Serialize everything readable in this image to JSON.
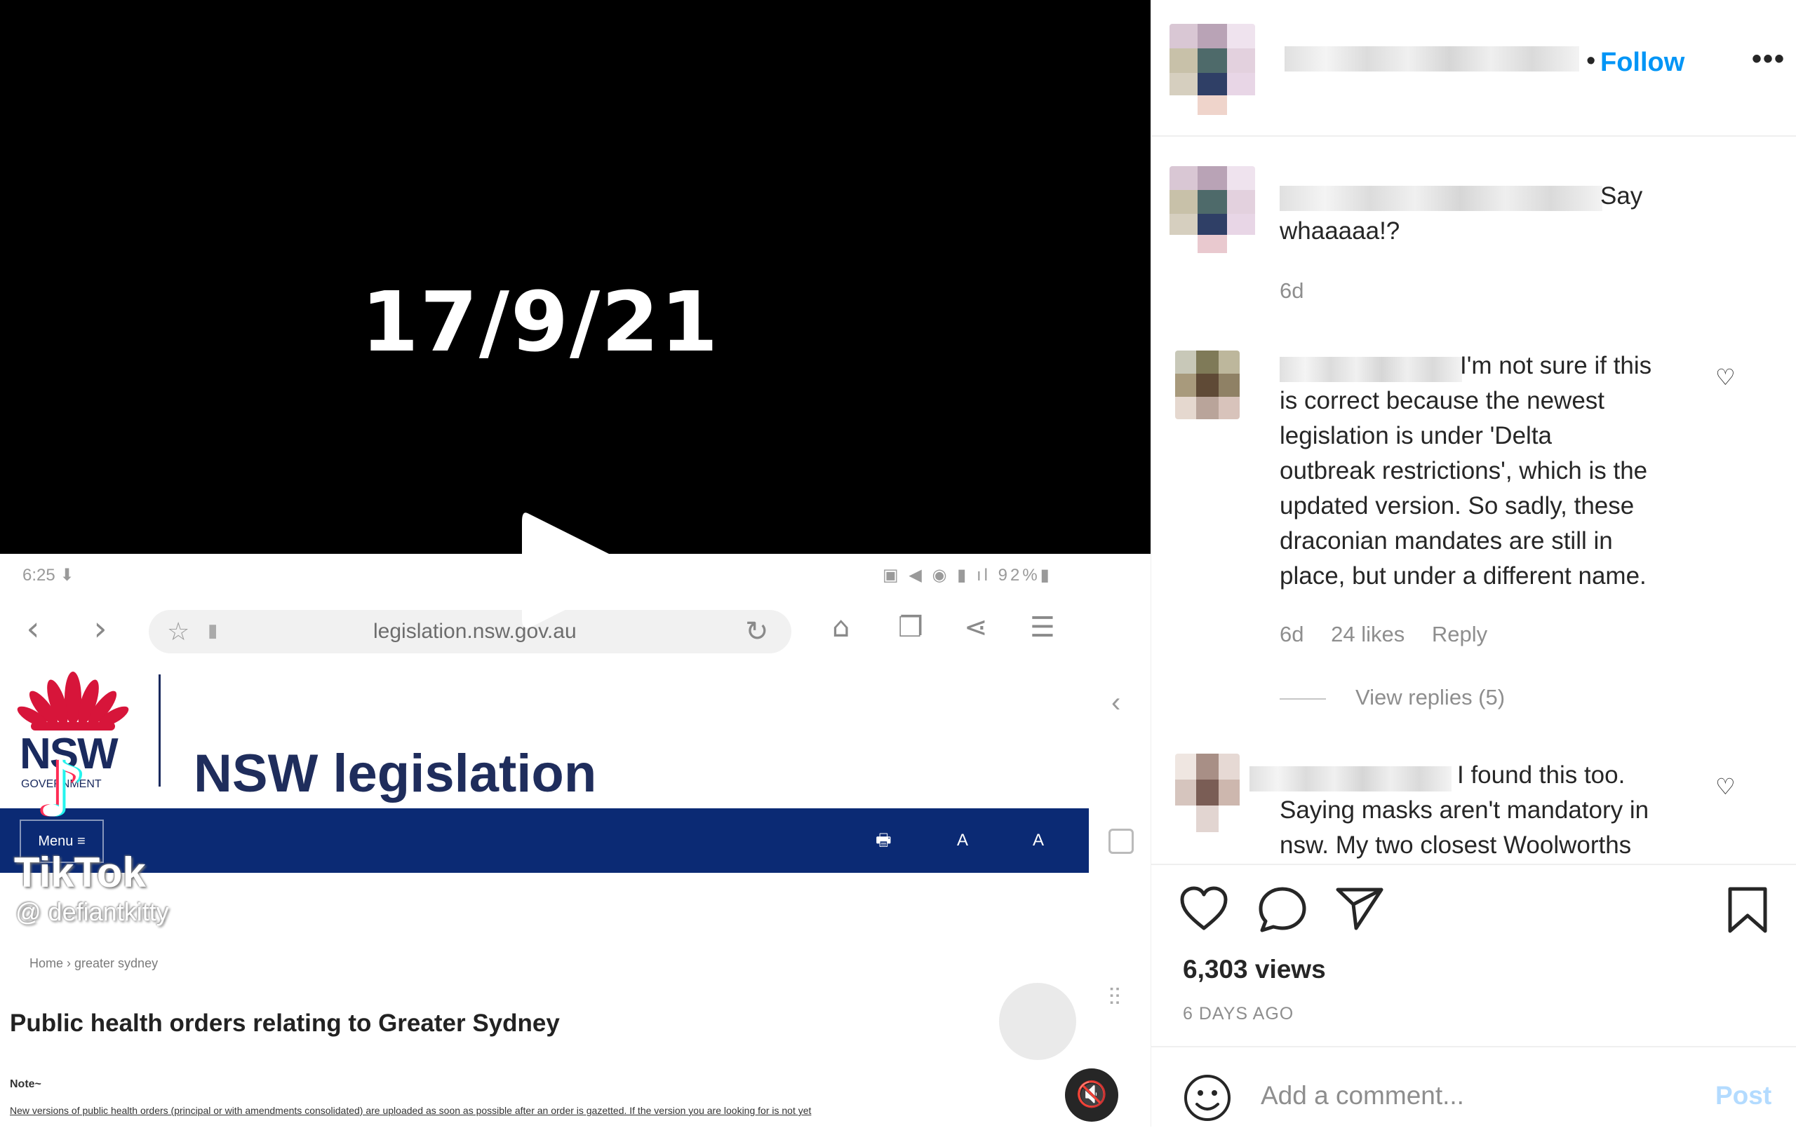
{
  "video": {
    "date_text": "17/9/21",
    "phone": {
      "status_time": "6:25 ⬇",
      "status_icons": "▣ ◀ ◉ ▮ ıl 92%▮",
      "url": "legislation.nsw.gov.au"
    },
    "site": {
      "logo_text": "NSW",
      "logo_subtext": "GOVERNMENT",
      "title": "NSW legislation",
      "menu_label": "Menu ≡",
      "toolbar_glyphs": "🖶 A A"
    },
    "tiktok": {
      "logo_glyph": "♪",
      "name": "TikTok",
      "handle": "@ defiantkitty"
    },
    "breadcrumb": "Home  ›  greater sydney",
    "page_heading": "Public health orders relating to Greater Sydney",
    "note_label": "Note~",
    "note_text": "New versions of public health orders (principal or with amendments consolidated) are uploaded as soon as possible after an order is gazetted. If the version you are looking for is not yet"
  },
  "post": {
    "follow_label": "Follow",
    "follow_separator": "•",
    "more_label": "•••"
  },
  "comments": [
    {
      "text": "Say whaaaaa!?",
      "lines": [
        "Say",
        "whaaaaa!?"
      ],
      "age": "6d"
    },
    {
      "lines": [
        "I'm not sure if this",
        "is correct because the newest",
        "legislation is under 'Delta",
        "outbreak restrictions', which is the",
        "updated version. So sadly, these",
        "draconian mandates are still in",
        "place, but under a different name."
      ],
      "age": "6d",
      "likes": "24 likes",
      "reply_label": "Reply",
      "view_replies": "View replies (5)"
    },
    {
      "lines": [
        "I found this too.",
        "Saying masks aren't mandatory in",
        "nsw. My two closest Woolworths"
      ]
    }
  ],
  "stats": {
    "views": "6,303 views",
    "ago": "6 DAYS AGO"
  },
  "composer": {
    "placeholder": "Add a comment...",
    "post_label": "Post"
  },
  "colors": {
    "accent": "#0095f6",
    "nsw_blue": "#0b2a74",
    "nsw_red": "#d7153a"
  }
}
